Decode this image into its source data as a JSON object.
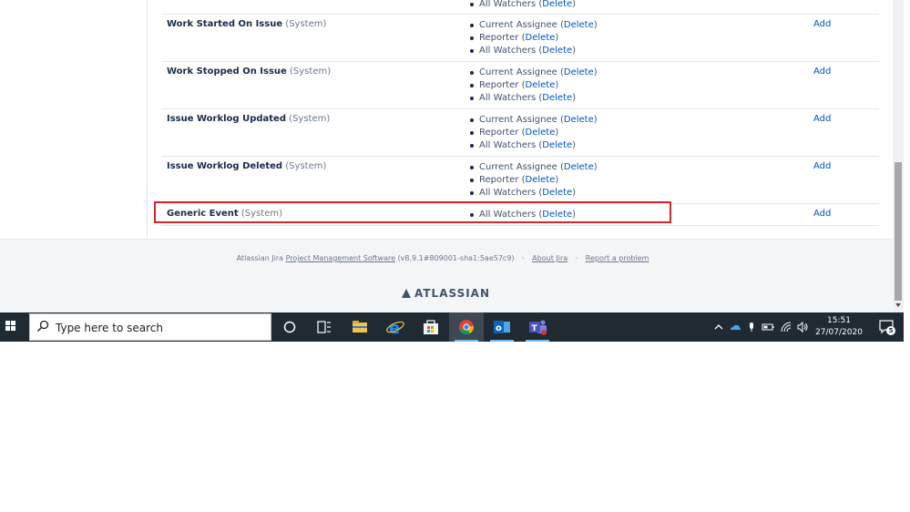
{
  "events": [
    {
      "name": "",
      "type": "",
      "notifications": [
        {
          "label": "All Watchers",
          "action": "Delete"
        }
      ],
      "add": ""
    },
    {
      "name": "Work Started On Issue",
      "type": "(System)",
      "notifications": [
        {
          "label": "Current Assignee",
          "action": "Delete"
        },
        {
          "label": "Reporter",
          "action": "Delete"
        },
        {
          "label": "All Watchers",
          "action": "Delete"
        }
      ],
      "add": "Add"
    },
    {
      "name": "Work Stopped On Issue",
      "type": "(System)",
      "notifications": [
        {
          "label": "Current Assignee",
          "action": "Delete"
        },
        {
          "label": "Reporter",
          "action": "Delete"
        },
        {
          "label": "All Watchers",
          "action": "Delete"
        }
      ],
      "add": "Add"
    },
    {
      "name": "Issue Worklog Updated",
      "type": "(System)",
      "notifications": [
        {
          "label": "Current Assignee",
          "action": "Delete"
        },
        {
          "label": "Reporter",
          "action": "Delete"
        },
        {
          "label": "All Watchers",
          "action": "Delete"
        }
      ],
      "add": "Add"
    },
    {
      "name": "Issue Worklog Deleted",
      "type": "(System)",
      "notifications": [
        {
          "label": "Current Assignee",
          "action": "Delete"
        },
        {
          "label": "Reporter",
          "action": "Delete"
        },
        {
          "label": "All Watchers",
          "action": "Delete"
        }
      ],
      "add": "Add"
    },
    {
      "name": "Generic Event",
      "type": "(System)",
      "notifications": [
        {
          "label": "All Watchers",
          "action": "Delete"
        }
      ],
      "add": "Add"
    }
  ],
  "footer": {
    "prefix": "Atlassian Jira",
    "link": "Project Management Software",
    "version": "(v8.9.1#809001-sha1:5ae57c9)",
    "about": "About Jira",
    "report": "Report a problem",
    "separator": "·",
    "brand": "ATLASSIAN"
  },
  "taskbar": {
    "search_placeholder": "Type here to search",
    "time": "15:51",
    "date": "27/07/2020",
    "notification_count": "5"
  },
  "colors": {
    "highlight": "#d9262c",
    "link": "#0052cc",
    "taskbar": "#1f2a33"
  }
}
